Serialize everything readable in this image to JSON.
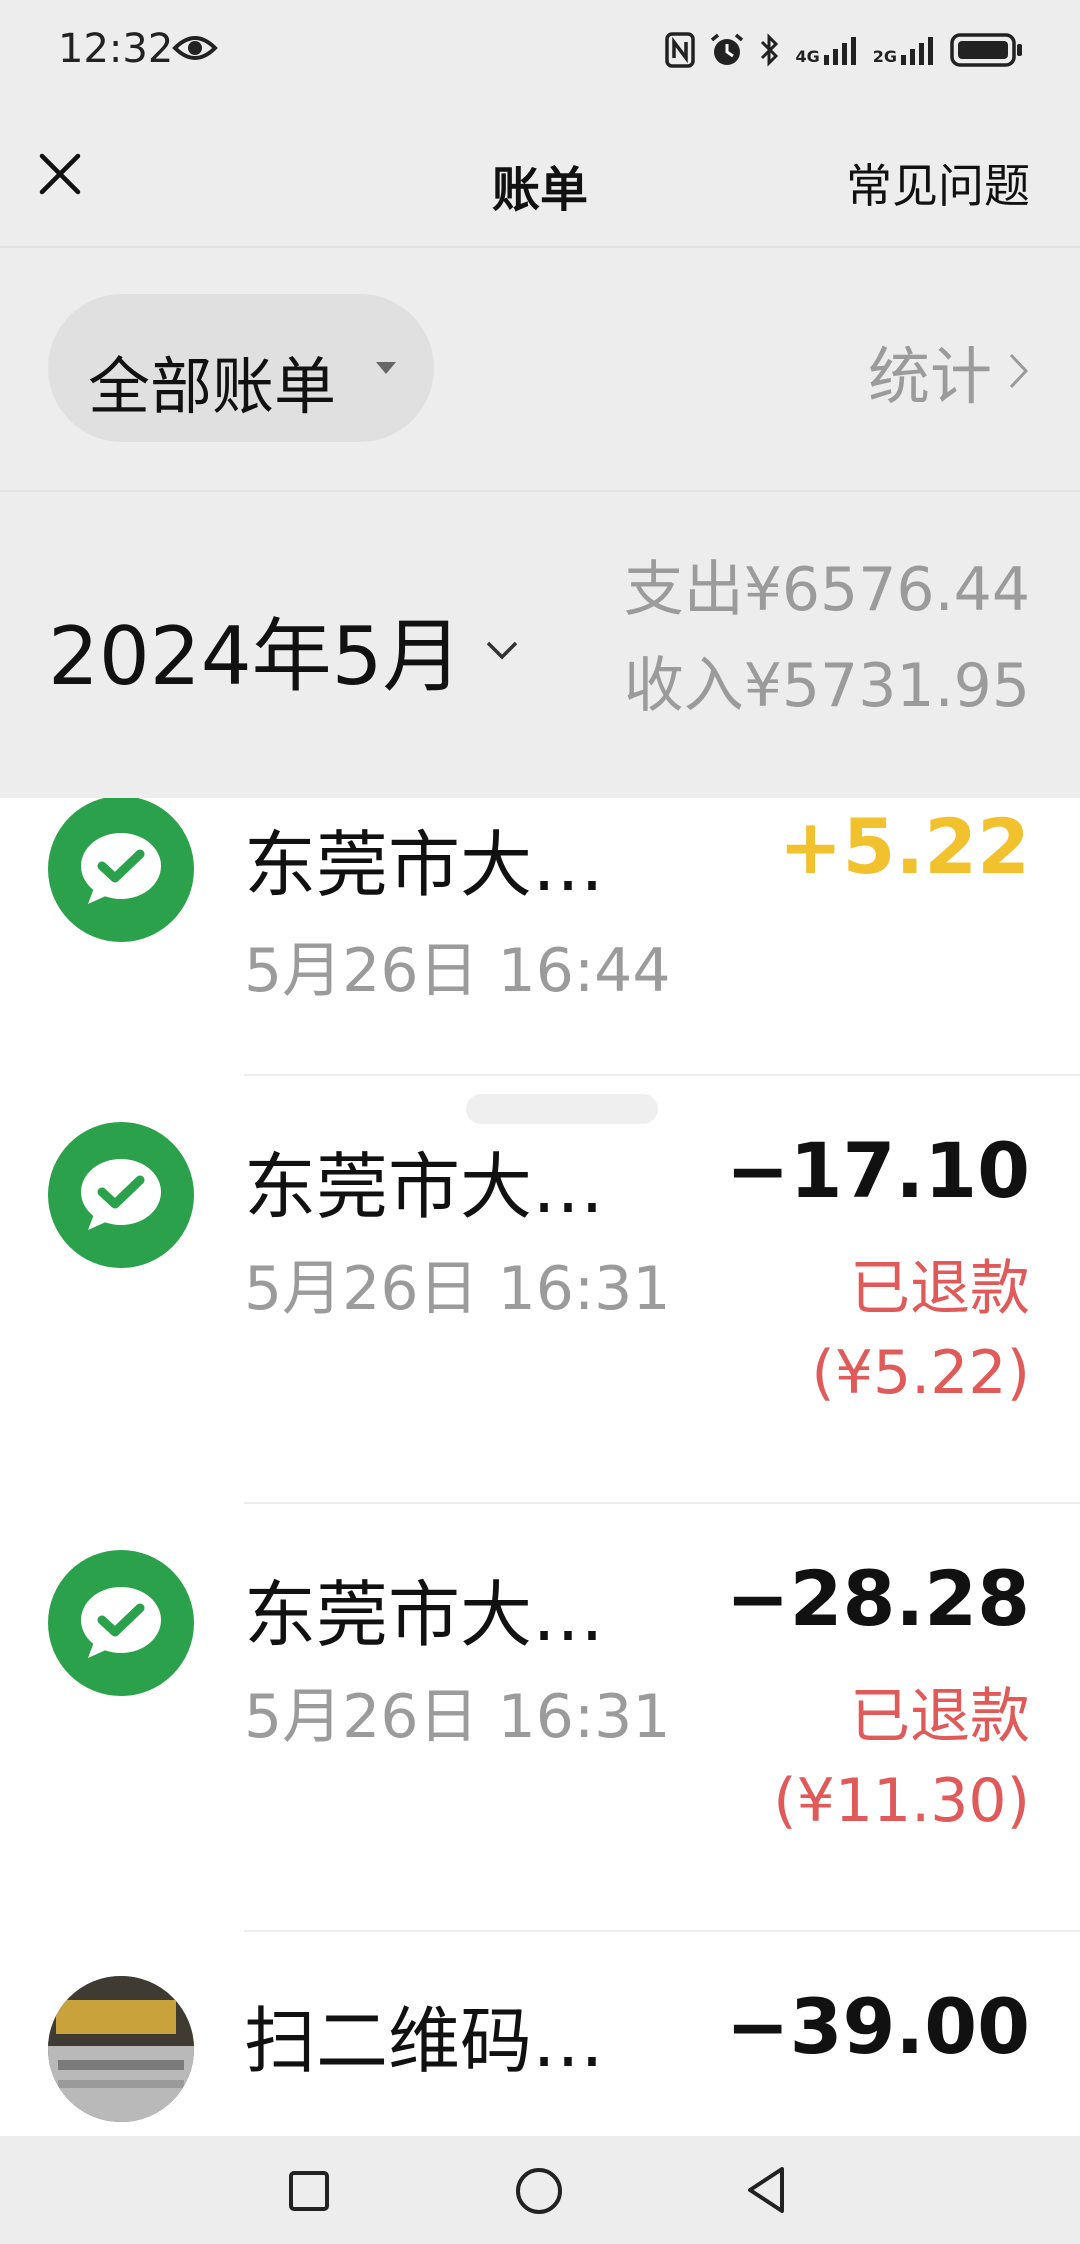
{
  "status_bar": {
    "time": "12:32",
    "network_1": "4G",
    "network_2": "2G",
    "icons": [
      "eye-icon",
      "nfc-icon",
      "alarm-icon",
      "bluetooth-icon",
      "signal-icon",
      "battery-icon"
    ]
  },
  "header": {
    "title": "账单",
    "help_label": "常见问题",
    "close_icon": "close-icon"
  },
  "filter": {
    "label": "全部账单",
    "stats_label": "统计"
  },
  "month": {
    "label": "2024年5月",
    "expense": "支出¥6576.44",
    "income": "收入¥5731.95"
  },
  "transactions": [
    {
      "title": "东莞市大…",
      "time": "5月26日 16:44",
      "amount": "+5.22",
      "type": "income",
      "avatar": "wechat-pay-icon"
    },
    {
      "title": "东莞市大…",
      "time": "5月26日 16:31",
      "amount": "−17.10",
      "status": "已退款",
      "refund": "(¥5.22)",
      "avatar": "wechat-pay-icon"
    },
    {
      "title": "东莞市大…",
      "time": "5月26日 16:31",
      "amount": "−28.28",
      "status": "已退款",
      "refund": "(¥11.30)",
      "avatar": "wechat-pay-icon"
    },
    {
      "title": "扫二维码…",
      "amount": "−39.00",
      "avatar": "merchant-photo"
    }
  ],
  "colors": {
    "background_header": "#ededed",
    "wechat_green": "#2aa14a",
    "income": "#f2c12e",
    "refund": "#e05a5a",
    "muted": "#9b9b9b"
  }
}
